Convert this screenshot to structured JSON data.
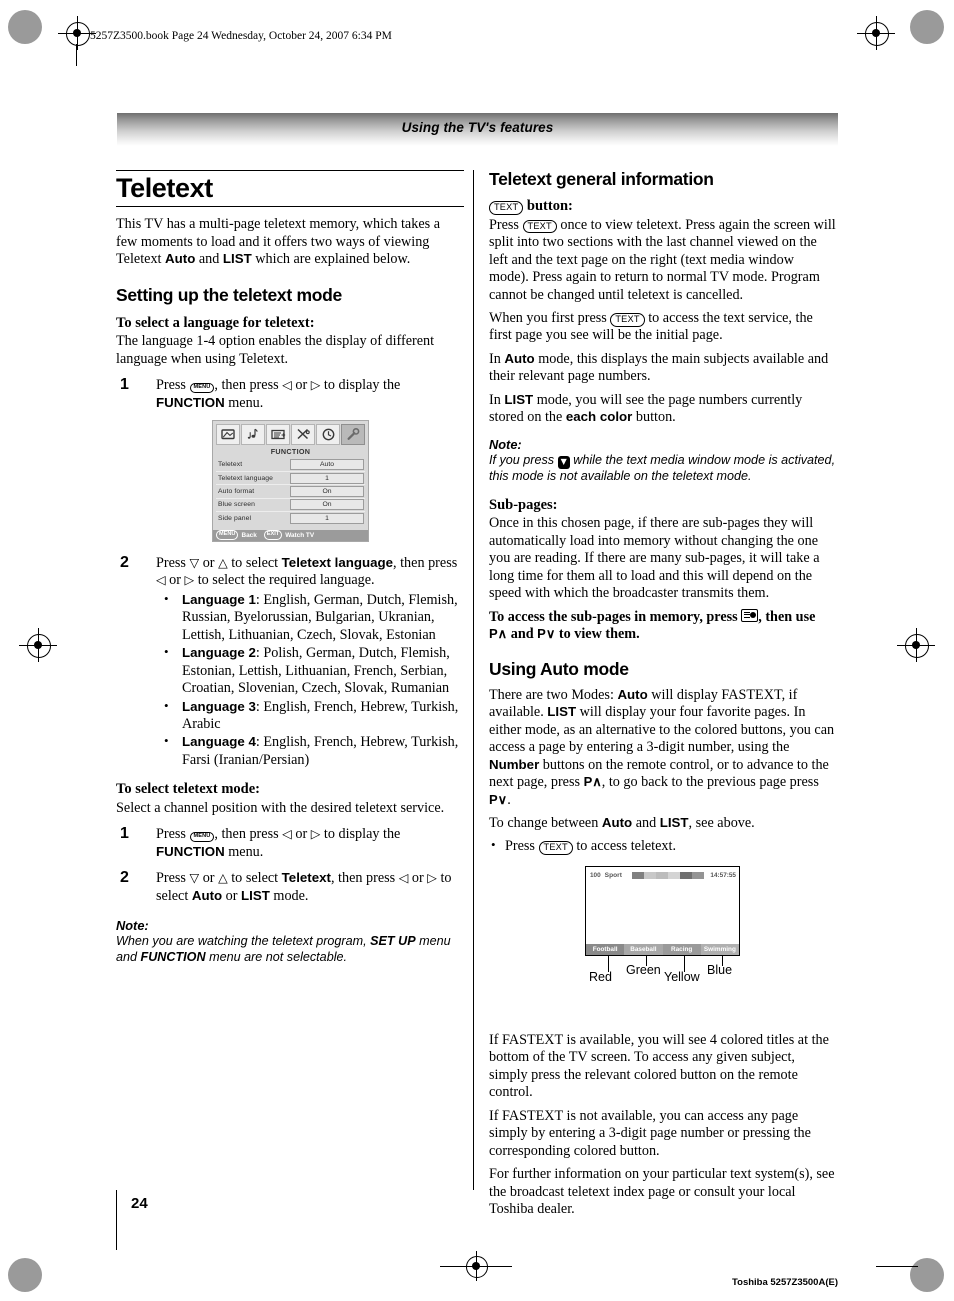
{
  "file_info": "5257Z3500.book  Page 24  Wednesday, October 24, 2007  6:34 PM",
  "header": {
    "band_title": "Using the TV's features"
  },
  "page_number": "24",
  "footer_right": "Toshiba 5257Z3500A(E)",
  "left_column": {
    "chapter_title": "Teletext",
    "intro": {
      "part1": "This TV has a multi-page teletext memory, which takes a few moments to load and it offers two ways of viewing Teletext ",
      "bold1": "Auto",
      "mid": " and ",
      "bold2": "LIST",
      "part2": " which are explained below."
    },
    "section_title": "Setting up the teletext mode",
    "sub1_title": "To select a language for teletext:",
    "sub1_body": "The language 1-4 option enables the display of different language when using Teletext.",
    "step1": {
      "num": "1",
      "pre": "Press ",
      "btn": "MENU",
      "mid": ", then press ",
      "mid2": " or ",
      "mid3": " to display the ",
      "bold": "FUNCTION",
      "post": " menu."
    },
    "step2": {
      "num": "2",
      "pre": "Press ",
      "mid1": " or ",
      "mid2": " to select ",
      "bold1": "Teletext language",
      "mid3": ", then press ",
      "mid4": " or ",
      "mid5": " to select the required language."
    },
    "languages": [
      {
        "label": "Language 1",
        "list": ": English, German, Dutch, Flemish, Russian, Byelorussian, Bulgarian, Ukranian, Lettish, Lithuanian, Czech, Slovak, Estonian"
      },
      {
        "label": "Language 2",
        "list": ": Polish, German, Dutch, Flemish, Estonian, Lettish, Lithuanian, French, Serbian, Croatian, Slovenian, Czech, Slovak, Rumanian"
      },
      {
        "label": "Language 3",
        "list": ": English, French, Hebrew, Turkish, Arabic"
      },
      {
        "label": "Language 4",
        "list": ": English, French, Hebrew, Turkish, Farsi (Iranian/Persian)"
      }
    ],
    "sub2_title": "To select teletext mode:",
    "sub2_body": "Select a channel position with the desired teletext service.",
    "step3": {
      "num": "1",
      "pre": "Press ",
      "btn": "MENU",
      "mid": ", then press ",
      "mid2": " or ",
      "mid3": " to display the ",
      "bold": "FUNCTION",
      "post": " menu."
    },
    "step4": {
      "num": "2",
      "pre": "Press ",
      "mid1": " or ",
      "mid2": " to select ",
      "bold1": "Teletext",
      "mid3": ", then press ",
      "mid4": " or ",
      "mid5": " to select ",
      "bold2": "Auto",
      "mid6": " or ",
      "bold3": "LIST",
      "post": " mode."
    },
    "note": {
      "title": "Note:",
      "pre": "When you are watching the teletext program, ",
      "bold1": "SET UP",
      "mid": " menu and ",
      "bold2": "FUNCTION",
      "post": " menu are not selectable."
    },
    "osd_menu": {
      "title": "FUNCTION",
      "icons": [
        "picture-icon",
        "sound-icon",
        "setup-icon",
        "install-icon",
        "timer-icon",
        "function-wrench-icon"
      ],
      "selected_icon_index": 5,
      "rows": [
        {
          "label": "Teletext",
          "value": "Auto"
        },
        {
          "label": "Teletext language",
          "value": "1"
        },
        {
          "label": "Auto format",
          "value": "On"
        },
        {
          "label": "Blue screen",
          "value": "On"
        },
        {
          "label": "Side panel",
          "value": "1"
        }
      ],
      "footer": [
        {
          "key": "MENU",
          "action": "Back"
        },
        {
          "key": "EXIT",
          "action": "Watch TV"
        }
      ]
    }
  },
  "right_column": {
    "section1_title": "Teletext general information",
    "text_button_heading": {
      "btn": "TEXT",
      "label": " button:"
    },
    "p1": {
      "pre": "Press ",
      "btn": "TEXT",
      "post": " once to view teletext. Press again the screen will split into two sections with the last channel viewed on the left and the text page on the right (text media window mode). Press again to return to normal TV mode. Program cannot be changed until teletext is cancelled."
    },
    "p2": {
      "pre": "When you first press ",
      "btn": "TEXT",
      "post": " to access the text service, the first page you see will be the initial page."
    },
    "p3": {
      "pre": "In ",
      "bold": "Auto",
      "post": " mode, this displays the main subjects available and their relevant page numbers."
    },
    "p4": {
      "pre": "In ",
      "bold1": "LIST",
      "mid": " mode, you will see the page numbers currently stored on the ",
      "bold2": "each color",
      "post": " button."
    },
    "note": {
      "title": "Note:",
      "pre": "If you press ",
      "btn": "down-arrow",
      "post": " while the text media window mode is activated, this mode is not available on the teletext mode."
    },
    "subpages_title": "Sub-pages:",
    "subpages_body": "Once in this chosen page, if there are sub-pages they will automatically load into memory without changing the one you are reading. If there are many sub-pages, it will take a long time for them all to load and this will depend on the speed with which the broadcaster transmits them.",
    "subpages_bold": {
      "pre": "To access the sub-pages in memory, press ",
      "btn": "index-icon",
      "mid": ", then use ",
      "pup": "P∧",
      "mid2": " and ",
      "pdn": "P∨",
      "post": " to view them."
    },
    "section2_title": "Using Auto mode",
    "p5": {
      "pre": "There are two Modes: ",
      "bold1": "Auto",
      "t1": " will display FASTEXT, if available. ",
      "bold2": "LIST",
      "t2": " will display your four favorite pages. In either mode, as an alternative to the colored buttons, you can access a page by entering a 3-digit number, using the ",
      "bold3": "Number",
      "t3": " buttons on the remote control, or to advance to the next page, press ",
      "pup": "P∧",
      "t4": ", to go back to the previous page press ",
      "pdn": "P∨",
      "t5": "."
    },
    "p6": {
      "pre": "To change between ",
      "bold1": "Auto",
      "mid": " and ",
      "bold2": "LIST",
      "post": ", see above."
    },
    "bullet1": {
      "pre": "Press ",
      "btn": "TEXT",
      "post": " to access teletext."
    },
    "tv_illustration": {
      "page_number": "100",
      "channel_name": "Sport",
      "clock": "14:57:55",
      "fastext_titles": [
        "Football",
        "Baseball",
        "Racing",
        "Swimming"
      ],
      "color_labels": [
        "Red",
        "Green",
        "Yellow",
        "Blue"
      ],
      "top_block_colors": [
        "#808080",
        "#c8c8c8",
        "#b4b4b4",
        "#d2d2d2",
        "#707070",
        "#909090"
      ],
      "bottom_cell_colors": [
        "#8a8a8a",
        "#a8a8a8",
        "#9a9a9a",
        "#b0b0b0"
      ]
    },
    "p7": "If FASTEXT is available, you will see 4 colored titles at the bottom of the TV screen. To access any given subject, simply press the relevant colored button on the remote control.",
    "p8": "If FASTEXT is not available, you can access any page simply by entering a 3-digit page number or pressing the corresponding colored button.",
    "p9": "For further information on your particular text system(s), see the broadcast teletext index page or consult your local Toshiba dealer."
  }
}
